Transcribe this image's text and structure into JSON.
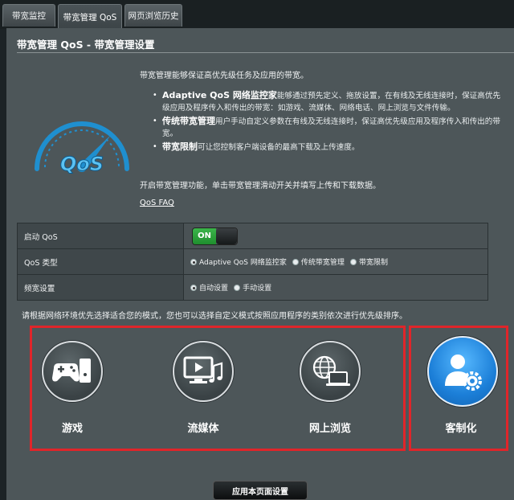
{
  "tabs": [
    {
      "label": "带宽监控"
    },
    {
      "label": "带宽管理 QoS"
    },
    {
      "label": "网页浏览历史"
    }
  ],
  "page_title": "带宽管理 QoS - 带宽管理设置",
  "logo_text": "QoS",
  "intro": "带宽管理能够保证高优先级任务及应用的带宽。",
  "bullets": [
    {
      "title": "Adaptive QoS 网络监控家",
      "text": "能够通过预先定义、拖放设置，在有线及无线连接时，保证高优先级应用及程序传入和传出的带宽：如游戏、流媒体、网络电话、网上浏览与文件传输。"
    },
    {
      "title": "传统带宽管理",
      "text": "用户手动自定义参数在有线及无线连接时，保证高优先级应用及程序传入和传出的带宽。"
    },
    {
      "title": "带宽限制",
      "text": "可让您控制客户端设备的最高下载及上传速度。"
    }
  ],
  "enable_note": "开启带宽管理功能，单击带宽管理滑动开关并填写上传和下载数据。",
  "faq_link": "QoS FAQ",
  "settings": {
    "enable_label": "启动 QoS",
    "toggle_state": "ON",
    "type_label": "QoS 类型",
    "type_options": [
      "Adaptive QoS 网络监控家",
      "传统带宽管理",
      "带宽限制"
    ],
    "type_selected": 0,
    "bandwidth_label": "频宽设置",
    "bandwidth_options": [
      "自动设置",
      "手动设置"
    ],
    "bandwidth_selected": 0
  },
  "mode_hint": "请根据网络环境优先选择适合您的模式，您也可以选择自定义模式按照应用程序的类别依次进行优先级排序。",
  "modes": [
    {
      "label": "游戏",
      "icon": "gamepad-icon"
    },
    {
      "label": "流媒体",
      "icon": "media-streaming-icon"
    },
    {
      "label": "网上浏览",
      "icon": "web-browsing-icon"
    }
  ],
  "custom_mode": {
    "label": "客制化",
    "icon": "user-gear-icon"
  },
  "apply_button": "应用本页面设置",
  "colors": {
    "highlight_border": "#e0252a",
    "toggle_on": "#2aa33b",
    "logo_blue": "#1f8fcf"
  }
}
